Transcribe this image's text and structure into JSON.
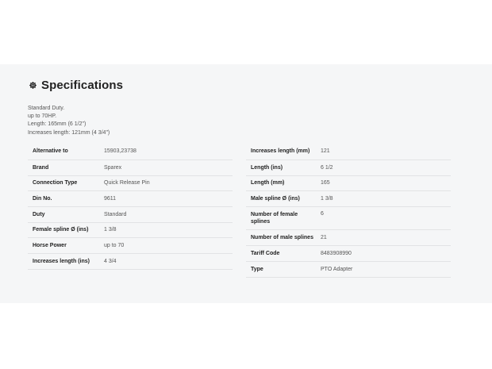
{
  "section": {
    "title": "Specifications",
    "icon": "gear-icon"
  },
  "intro": [
    "Standard Duty.",
    "up to 70HP.",
    "Length: 165mm (6 1/2\")",
    "Increases length: 121mm (4 3/4\")"
  ],
  "left_table": [
    {
      "label": "Alternative to",
      "value": "15903,23738"
    },
    {
      "label": "Brand",
      "value": "Sparex"
    },
    {
      "label": "Connection Type",
      "value": "Quick Release Pin"
    },
    {
      "label": "Din No.",
      "value": "9611"
    },
    {
      "label": "Duty",
      "value": "Standard"
    },
    {
      "label": "Female spline Ø (ins)",
      "value": "1 3/8"
    },
    {
      "label": "Horse Power",
      "value": "up to 70"
    },
    {
      "label": "Increases length (ins)",
      "value": "4 3/4"
    }
  ],
  "right_table": [
    {
      "label": "Increases length (mm)",
      "value": "121"
    },
    {
      "label": "Length (ins)",
      "value": "6 1/2"
    },
    {
      "label": "Length (mm)",
      "value": "165"
    },
    {
      "label": "Male spline Ø (ins)",
      "value": "1 3/8"
    },
    {
      "label": "Number of female splines",
      "value": "6"
    },
    {
      "label": "Number of male splines",
      "value": "21"
    },
    {
      "label": "Tariff Code",
      "value": "8483908990"
    },
    {
      "label": "Type",
      "value": "PTO Adapter"
    }
  ]
}
